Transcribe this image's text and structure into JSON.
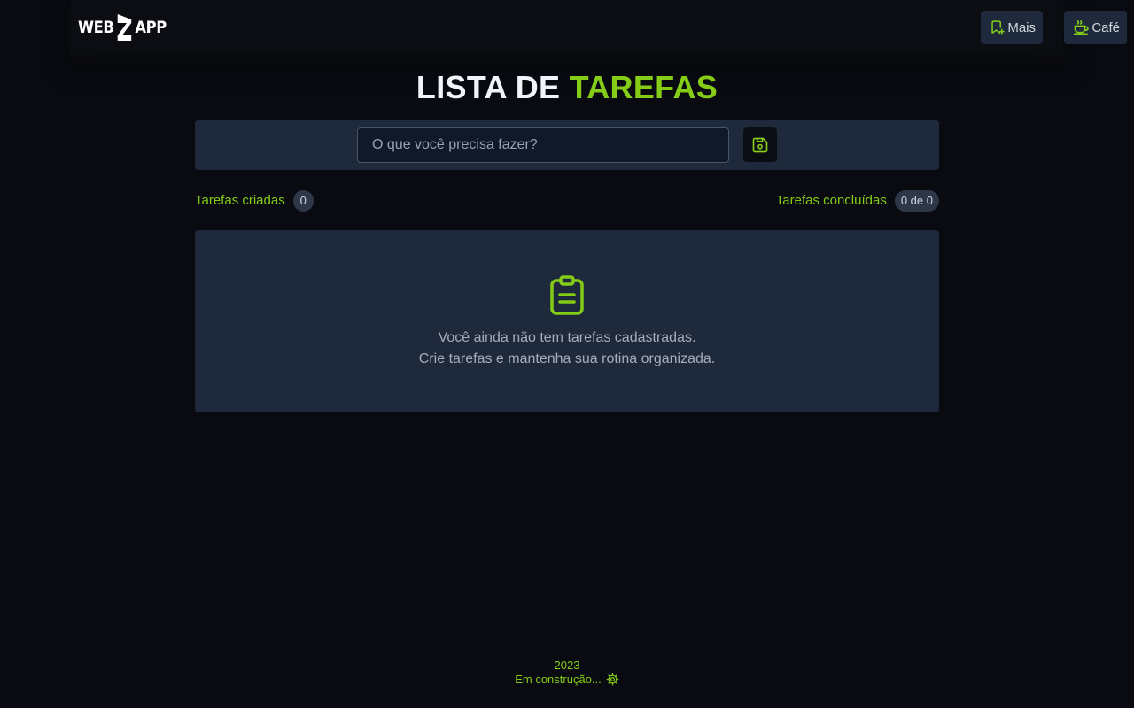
{
  "header": {
    "logo": {
      "left": "WEB",
      "right": "APP"
    },
    "buttons": [
      {
        "label": "Mais",
        "icon": "bookmark-plus-icon"
      },
      {
        "label": "Café",
        "icon": "coffee-icon"
      }
    ]
  },
  "title": {
    "part1": "LISTA DE ",
    "part2": "TAREFAS"
  },
  "form": {
    "placeholder": "O que você precisa fazer?",
    "value": "",
    "save_icon": "save-icon"
  },
  "counters": {
    "created_label": "Tarefas criadas",
    "created_count": "0",
    "completed_label": "Tarefas concluídas",
    "completed_count": "0 de 0"
  },
  "empty_state": {
    "icon": "clipboard-icon",
    "line1": "Você ainda não tem tarefas cadastradas.",
    "line2": "Crie tarefas e mantenha sua rotina organizada."
  },
  "footer": {
    "year": "2023",
    "status": "Em construção...",
    "status_icon": "gear-icon"
  },
  "colors": {
    "accent": "#84cc16",
    "background": "#090b11",
    "panel": "#1e293b"
  }
}
